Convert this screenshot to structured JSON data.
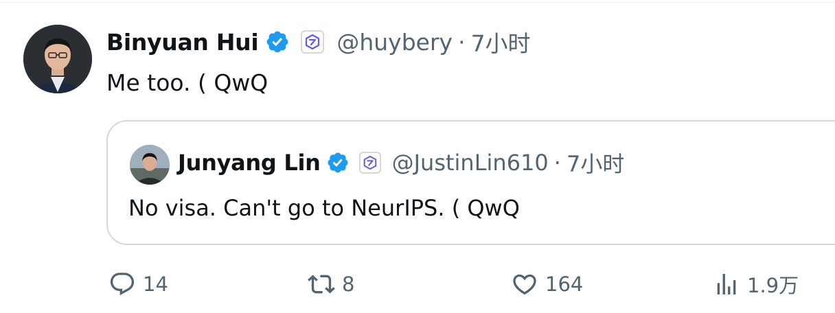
{
  "tweet": {
    "author_name": "Binyuan Hui",
    "handle": "@huybery",
    "separator": "·",
    "time": "7小时",
    "text": "Me too. ( QwQ"
  },
  "quoted_tweet": {
    "author_name": "Junyang Lin",
    "handle": "@JustinLin610",
    "separator": "·",
    "time": "7小时",
    "text": "No visa. Can't go to NeurIPS. ( QwQ"
  },
  "actions": {
    "replies": "14",
    "reposts": "8",
    "likes": "164",
    "views": "1.9万"
  },
  "colors": {
    "verified": "#1d9bf0",
    "secondary_text": "#536471",
    "border": "#cfd9de",
    "affiliate_purple": "#615ced"
  },
  "icons": {
    "verified": "verified-badge-icon",
    "affiliate": "affiliate-logo-icon",
    "reply": "reply-icon",
    "repost": "repost-icon",
    "like": "like-icon",
    "views": "views-icon"
  }
}
